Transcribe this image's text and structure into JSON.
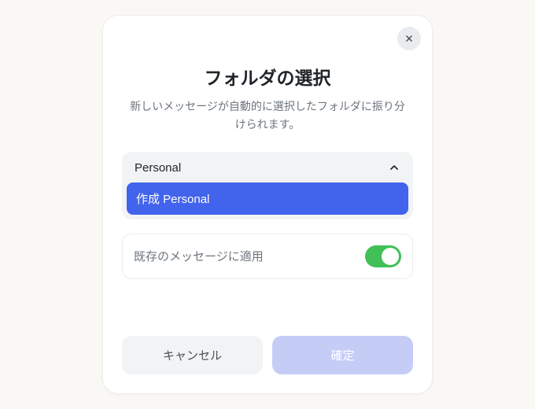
{
  "modal": {
    "title": "フォルダの選択",
    "subtitle": "新しいメッセージが自動的に選択したフォルダに振り分けられます。",
    "combo": {
      "value": "Personal",
      "option": "作成 Personal"
    },
    "apply": {
      "label": "既存のメッセージに適用",
      "on": true
    },
    "buttons": {
      "cancel": "キャンセル",
      "confirm": "確定"
    }
  }
}
